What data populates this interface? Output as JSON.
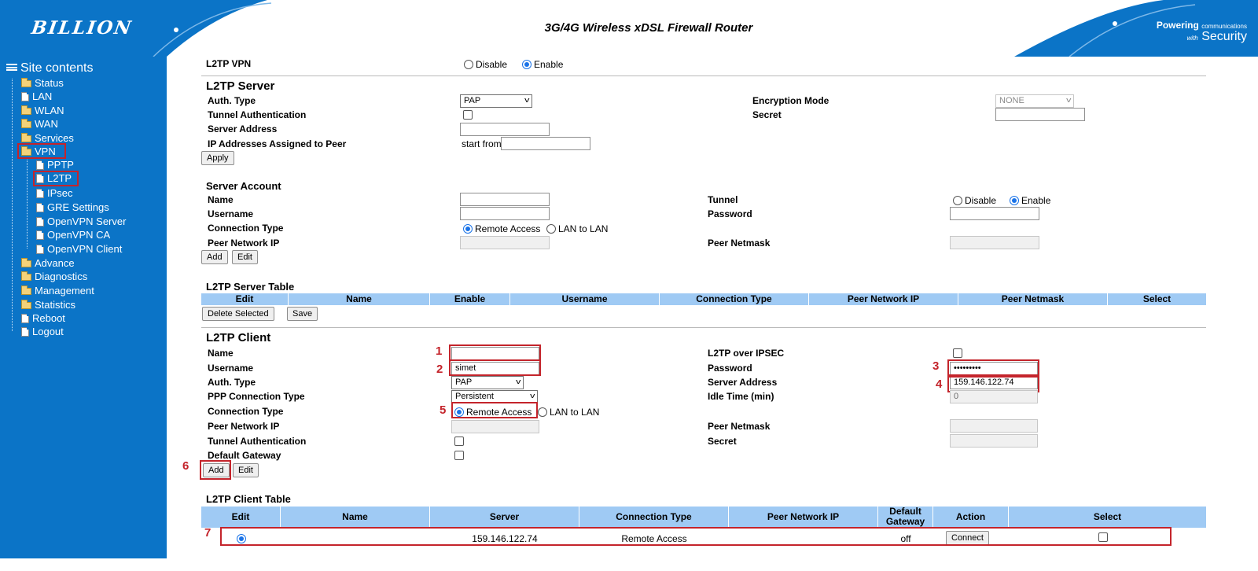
{
  "header": {
    "logo": "BILLION",
    "title": "3G/4G Wireless xDSL Firewall Router",
    "slogan_bold": "Powering",
    "slogan_small": "communications",
    "slogan_with": "with",
    "slogan_security": "Security"
  },
  "sidebar": {
    "title": "Site contents",
    "items": [
      {
        "label": "Status"
      },
      {
        "label": "LAN"
      },
      {
        "label": "WLAN"
      },
      {
        "label": "WAN"
      },
      {
        "label": "Services"
      },
      {
        "label": "VPN"
      },
      {
        "label": "PPTP"
      },
      {
        "label": "L2TP"
      },
      {
        "label": "IPsec"
      },
      {
        "label": "GRE Settings"
      },
      {
        "label": "OpenVPN Server"
      },
      {
        "label": "OpenVPN CA"
      },
      {
        "label": "OpenVPN Client"
      },
      {
        "label": "Advance"
      },
      {
        "label": "Diagnostics"
      },
      {
        "label": "Management"
      },
      {
        "label": "Statistics"
      },
      {
        "label": "Reboot"
      },
      {
        "label": "Logout"
      }
    ]
  },
  "vpn": {
    "label": "L2TP VPN",
    "disable": "Disable",
    "enable": "Enable"
  },
  "server": {
    "title": "L2TP Server",
    "auth_type_label": "Auth. Type",
    "auth_type_value": "PAP",
    "tunnel_auth_label": "Tunnel Authentication",
    "server_address_label": "Server Address",
    "ip_assigned_label": "IP Addresses Assigned to Peer",
    "start_from": "start from",
    "encryption_label": "Encryption Mode",
    "encryption_value": "NONE",
    "secret_label": "Secret",
    "apply": "Apply"
  },
  "account": {
    "title": "Server Account",
    "name_label": "Name",
    "username_label": "Username",
    "conn_type_label": "Connection Type",
    "remote_access": "Remote Access",
    "lan_to_lan": "LAN to LAN",
    "peer_ip_label": "Peer Network IP",
    "tunnel_label": "Tunnel",
    "disable": "Disable",
    "enable": "Enable",
    "password_label": "Password",
    "peer_netmask_label": "Peer Netmask",
    "add": "Add",
    "edit": "Edit"
  },
  "server_table": {
    "title": "L2TP Server Table",
    "headers": [
      "Edit",
      "Name",
      "Enable",
      "Username",
      "Connection Type",
      "Peer Network IP",
      "Peer Netmask",
      "Select"
    ],
    "delete_selected": "Delete Selected",
    "save": "Save"
  },
  "client": {
    "title": "L2TP Client",
    "name_label": "Name",
    "name_value": "",
    "username_label": "Username",
    "username_value": "simet",
    "auth_type_label": "Auth. Type",
    "auth_type_value": "PAP",
    "ppp_conn_label": "PPP Connection Type",
    "ppp_conn_value": "Persistent",
    "conn_type_label": "Connection Type",
    "remote_access": "Remote Access",
    "lan_to_lan": "LAN to LAN",
    "peer_ip_label": "Peer Network IP",
    "tunnel_auth_label": "Tunnel Authentication",
    "default_gw_label": "Default Gateway",
    "over_ipsec_label": "L2TP over IPSEC",
    "password_label": "Password",
    "password_value": "•••••••••",
    "server_addr_label": "Server Address",
    "server_addr_value": "159.146.122.74",
    "idle_label": "Idle Time (min)",
    "idle_value": "0",
    "peer_netmask_label": "Peer Netmask",
    "secret_label": "Secret",
    "add": "Add",
    "edit": "Edit"
  },
  "client_table": {
    "title": "L2TP Client Table",
    "headers": [
      "Edit",
      "Name",
      "Server",
      "Connection Type",
      "Peer Network IP",
      "Default Gateway",
      "Action",
      "Select"
    ],
    "row": {
      "name": "",
      "server": "159.146.122.74",
      "conn_type": "Remote Access",
      "peer_ip": "",
      "default_gw": "off",
      "action": "Connect"
    }
  },
  "annotations": [
    "1",
    "2",
    "3",
    "4",
    "5",
    "6",
    "7"
  ],
  "colors": {
    "sidebar": "#0b74c7",
    "table_header": "#9fcaf4",
    "annotation": "#c4242b"
  }
}
